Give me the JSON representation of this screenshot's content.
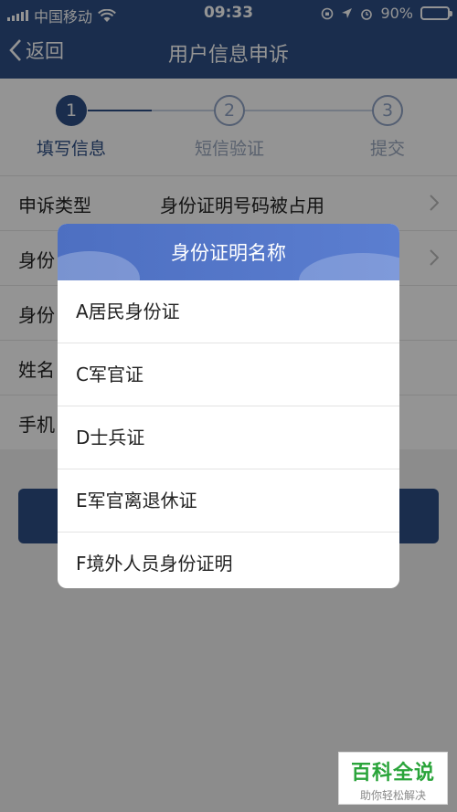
{
  "status_bar": {
    "carrier": "中国移动",
    "time": "09:33",
    "battery": "90%",
    "battery_level": 0.9
  },
  "nav": {
    "back_label": "返回",
    "title": "用户信息申诉"
  },
  "steps": [
    {
      "number": "1",
      "label": "填写信息",
      "active": true
    },
    {
      "number": "2",
      "label": "短信验证",
      "active": false
    },
    {
      "number": "3",
      "label": "提交",
      "active": false
    }
  ],
  "form": {
    "rows": [
      {
        "label": "申诉类型",
        "value": "身份证明号码被占用"
      },
      {
        "label": "身份"
      },
      {
        "label": "身份"
      },
      {
        "label": "姓名"
      },
      {
        "label": "手机"
      }
    ]
  },
  "dialog": {
    "title": "身份证明名称",
    "options": [
      "A居民身份证",
      "C军官证",
      "D士兵证",
      "E军官离退休证",
      "F境外人员身份证明"
    ]
  },
  "watermark": {
    "title": "百科全说",
    "subtitle": "助你轻松解决"
  },
  "colors": {
    "primary": "#2d4f86",
    "dialog_header": "#4d6fc1",
    "battery": "#4cd964"
  }
}
